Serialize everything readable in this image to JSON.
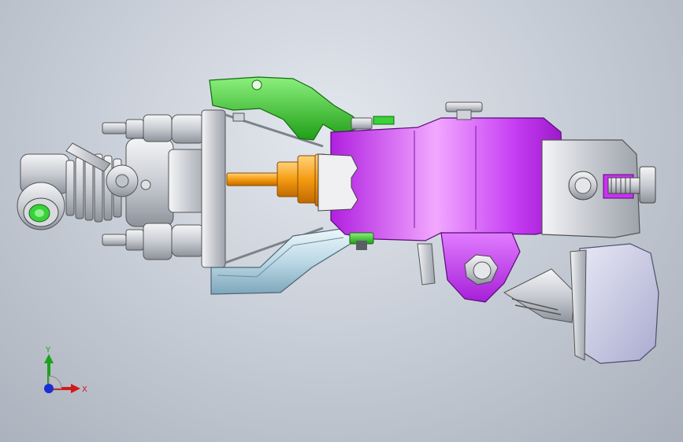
{
  "viewport": {
    "background_top": "#e3e7ee",
    "background_bottom": "#a9b0bb"
  },
  "model": {
    "parts": [
      {
        "name": "pipe-cylinder",
        "color": "#d9dde3"
      },
      {
        "name": "valve-body",
        "color": "#e0e3e8"
      },
      {
        "name": "top-green-bracket",
        "color": "#39d12e"
      },
      {
        "name": "purple-main-housing",
        "color": "#c832f0"
      },
      {
        "name": "orange-shaft",
        "color": "#f5a31a"
      },
      {
        "name": "lower-steel-bracket",
        "color": "#cfe6ef"
      },
      {
        "name": "right-grey-block",
        "color": "#c8cae0"
      }
    ]
  },
  "triad": {
    "x_label": "X",
    "y_label": "Y",
    "x_color": "#d11a1a",
    "y_color": "#1aa31a",
    "z_color": "#1a2fd1"
  }
}
